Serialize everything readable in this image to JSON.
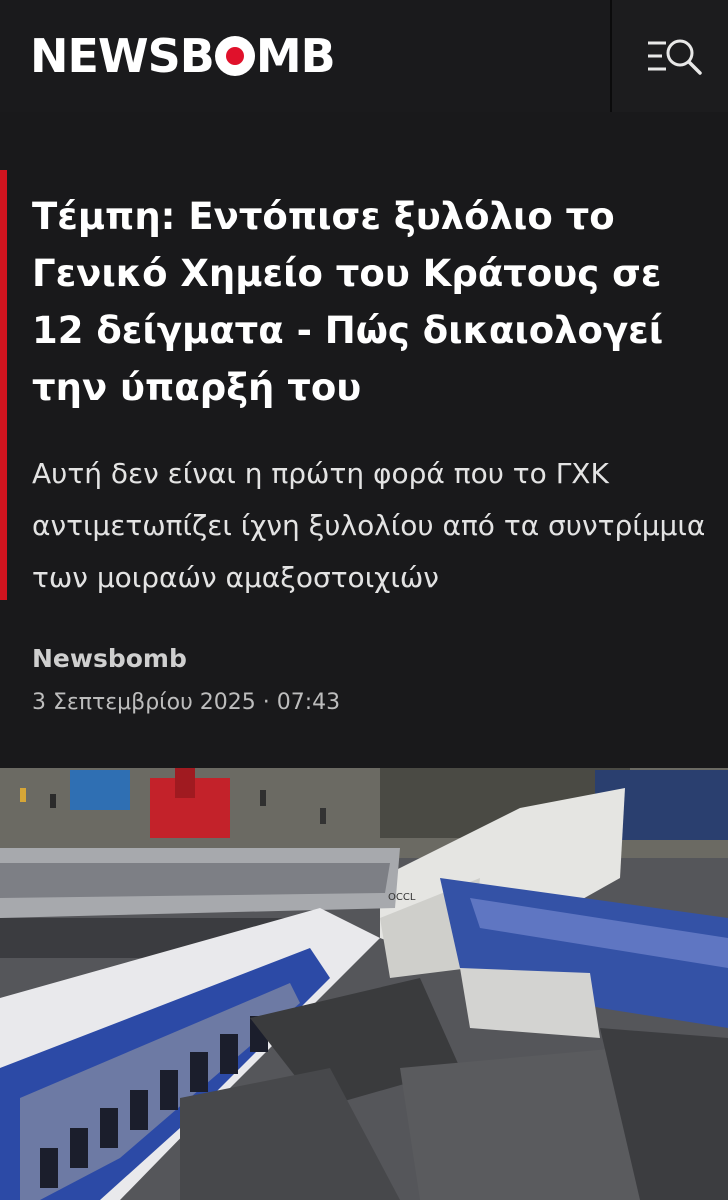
{
  "header": {
    "logo_text_left": "NEWSB",
    "logo_text_right": "MB",
    "menu_icon": "menu-search-icon"
  },
  "article": {
    "headline": "Τέμπη: Εντόπισε ξυλόλιο το Γενικό Χημείο του Κράτους σε 12 δείγματα - Πώς δικαιολογεί την ύπαρξή του",
    "subtitle": "Αυτή δεν είναι η πρώτη φορά που το ΓΧΚ αντιμετωπίζει ίχνη ξυλολίου από τα συντρίμμια των μοιραών αμαξοστοιχιών",
    "author": "Newsbomb",
    "date_time": "3 Σεπτεμβρίου 2025 · 07:43"
  },
  "photo": {
    "graffiti_text": "OCCL"
  },
  "colors": {
    "accent": "#d0141f",
    "background": "#19191b",
    "header_bg": "#1a1a1c"
  }
}
